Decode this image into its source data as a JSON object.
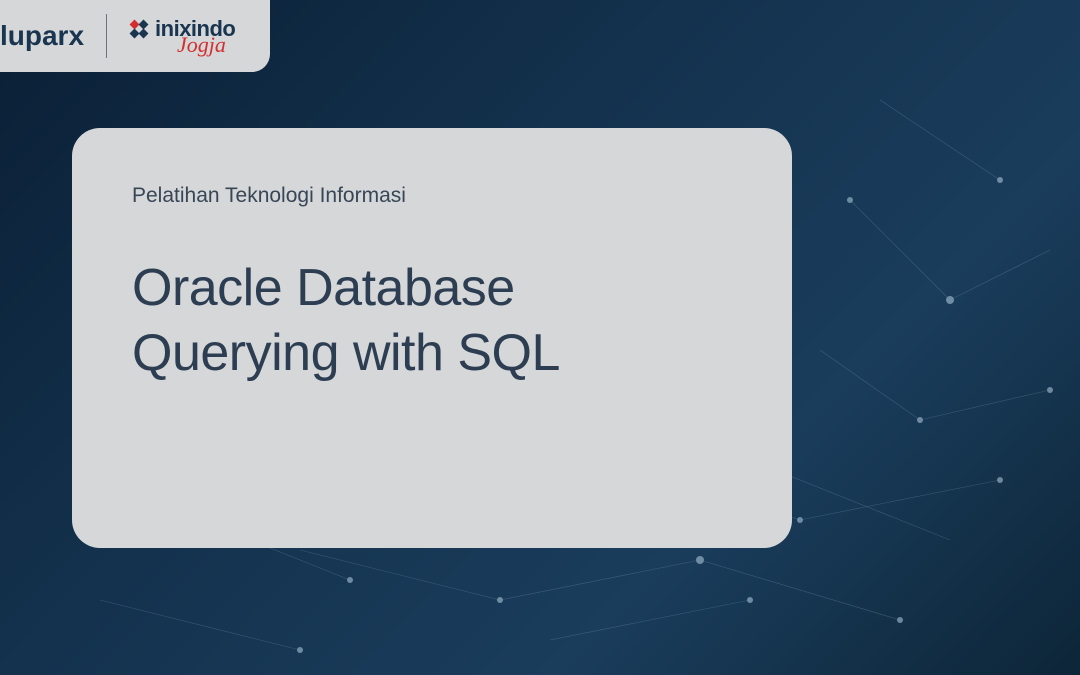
{
  "logos": {
    "left": {
      "text": "luparx"
    },
    "right": {
      "brand": "inixindo",
      "location": "Jogja"
    }
  },
  "card": {
    "subtitle": "Pelatihan Teknologi Informasi",
    "title_line1": "Oracle Database",
    "title_line2": "Querying with SQL"
  }
}
